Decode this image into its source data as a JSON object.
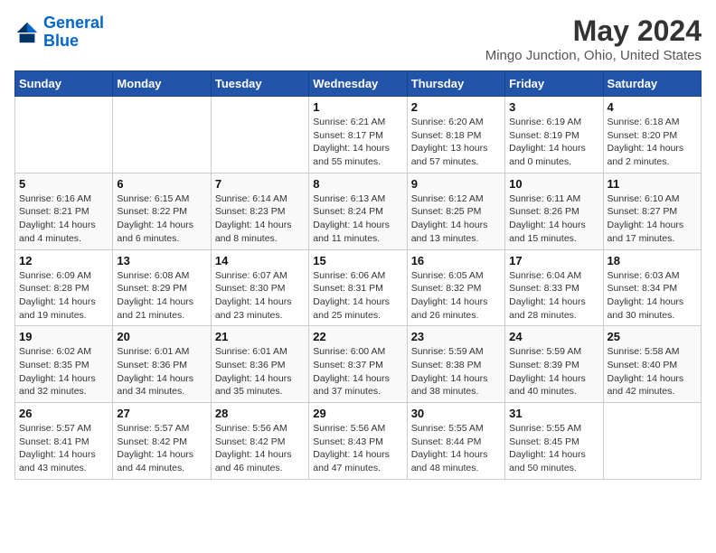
{
  "header": {
    "logo_line1": "General",
    "logo_line2": "Blue",
    "main_title": "May 2024",
    "subtitle": "Mingo Junction, Ohio, United States"
  },
  "days_of_week": [
    "Sunday",
    "Monday",
    "Tuesday",
    "Wednesday",
    "Thursday",
    "Friday",
    "Saturday"
  ],
  "weeks": [
    [
      {
        "day": "",
        "info": ""
      },
      {
        "day": "",
        "info": ""
      },
      {
        "day": "",
        "info": ""
      },
      {
        "day": "1",
        "info": "Sunrise: 6:21 AM\nSunset: 8:17 PM\nDaylight: 14 hours and 55 minutes."
      },
      {
        "day": "2",
        "info": "Sunrise: 6:20 AM\nSunset: 8:18 PM\nDaylight: 13 hours and 57 minutes."
      },
      {
        "day": "3",
        "info": "Sunrise: 6:19 AM\nSunset: 8:19 PM\nDaylight: 14 hours and 0 minutes."
      },
      {
        "day": "4",
        "info": "Sunrise: 6:18 AM\nSunset: 8:20 PM\nDaylight: 14 hours and 2 minutes."
      }
    ],
    [
      {
        "day": "5",
        "info": "Sunrise: 6:16 AM\nSunset: 8:21 PM\nDaylight: 14 hours and 4 minutes."
      },
      {
        "day": "6",
        "info": "Sunrise: 6:15 AM\nSunset: 8:22 PM\nDaylight: 14 hours and 6 minutes."
      },
      {
        "day": "7",
        "info": "Sunrise: 6:14 AM\nSunset: 8:23 PM\nDaylight: 14 hours and 8 minutes."
      },
      {
        "day": "8",
        "info": "Sunrise: 6:13 AM\nSunset: 8:24 PM\nDaylight: 14 hours and 11 minutes."
      },
      {
        "day": "9",
        "info": "Sunrise: 6:12 AM\nSunset: 8:25 PM\nDaylight: 14 hours and 13 minutes."
      },
      {
        "day": "10",
        "info": "Sunrise: 6:11 AM\nSunset: 8:26 PM\nDaylight: 14 hours and 15 minutes."
      },
      {
        "day": "11",
        "info": "Sunrise: 6:10 AM\nSunset: 8:27 PM\nDaylight: 14 hours and 17 minutes."
      }
    ],
    [
      {
        "day": "12",
        "info": "Sunrise: 6:09 AM\nSunset: 8:28 PM\nDaylight: 14 hours and 19 minutes."
      },
      {
        "day": "13",
        "info": "Sunrise: 6:08 AM\nSunset: 8:29 PM\nDaylight: 14 hours and 21 minutes."
      },
      {
        "day": "14",
        "info": "Sunrise: 6:07 AM\nSunset: 8:30 PM\nDaylight: 14 hours and 23 minutes."
      },
      {
        "day": "15",
        "info": "Sunrise: 6:06 AM\nSunset: 8:31 PM\nDaylight: 14 hours and 25 minutes."
      },
      {
        "day": "16",
        "info": "Sunrise: 6:05 AM\nSunset: 8:32 PM\nDaylight: 14 hours and 26 minutes."
      },
      {
        "day": "17",
        "info": "Sunrise: 6:04 AM\nSunset: 8:33 PM\nDaylight: 14 hours and 28 minutes."
      },
      {
        "day": "18",
        "info": "Sunrise: 6:03 AM\nSunset: 8:34 PM\nDaylight: 14 hours and 30 minutes."
      }
    ],
    [
      {
        "day": "19",
        "info": "Sunrise: 6:02 AM\nSunset: 8:35 PM\nDaylight: 14 hours and 32 minutes."
      },
      {
        "day": "20",
        "info": "Sunrise: 6:01 AM\nSunset: 8:36 PM\nDaylight: 14 hours and 34 minutes."
      },
      {
        "day": "21",
        "info": "Sunrise: 6:01 AM\nSunset: 8:36 PM\nDaylight: 14 hours and 35 minutes."
      },
      {
        "day": "22",
        "info": "Sunrise: 6:00 AM\nSunset: 8:37 PM\nDaylight: 14 hours and 37 minutes."
      },
      {
        "day": "23",
        "info": "Sunrise: 5:59 AM\nSunset: 8:38 PM\nDaylight: 14 hours and 38 minutes."
      },
      {
        "day": "24",
        "info": "Sunrise: 5:59 AM\nSunset: 8:39 PM\nDaylight: 14 hours and 40 minutes."
      },
      {
        "day": "25",
        "info": "Sunrise: 5:58 AM\nSunset: 8:40 PM\nDaylight: 14 hours and 42 minutes."
      }
    ],
    [
      {
        "day": "26",
        "info": "Sunrise: 5:57 AM\nSunset: 8:41 PM\nDaylight: 14 hours and 43 minutes."
      },
      {
        "day": "27",
        "info": "Sunrise: 5:57 AM\nSunset: 8:42 PM\nDaylight: 14 hours and 44 minutes."
      },
      {
        "day": "28",
        "info": "Sunrise: 5:56 AM\nSunset: 8:42 PM\nDaylight: 14 hours and 46 minutes."
      },
      {
        "day": "29",
        "info": "Sunrise: 5:56 AM\nSunset: 8:43 PM\nDaylight: 14 hours and 47 minutes."
      },
      {
        "day": "30",
        "info": "Sunrise: 5:55 AM\nSunset: 8:44 PM\nDaylight: 14 hours and 48 minutes."
      },
      {
        "day": "31",
        "info": "Sunrise: 5:55 AM\nSunset: 8:45 PM\nDaylight: 14 hours and 50 minutes."
      },
      {
        "day": "",
        "info": ""
      }
    ]
  ]
}
